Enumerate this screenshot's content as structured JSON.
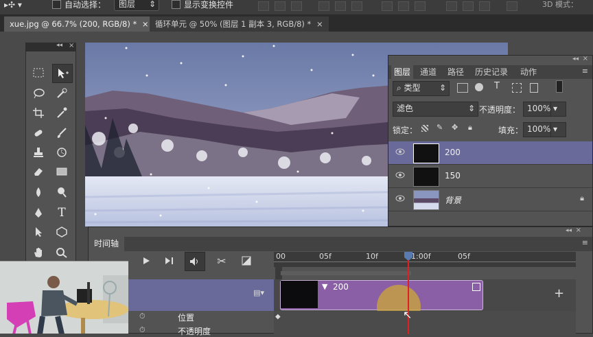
{
  "option_bar": {
    "auto_select_label": "自动选择：",
    "auto_select_value": "图层",
    "show_transform_label": "显示变换控件",
    "mode_3d_label": "3D 模式："
  },
  "doc_tabs": [
    {
      "label": "xue.jpg @ 66.7% (200, RGB/8) *",
      "close": "×"
    },
    {
      "label": "循环单元 @ 50% (图层 1 副本 3, RGB/8) *",
      "close": "×"
    }
  ],
  "tools": {
    "collapse": "◂◂",
    "close": "×",
    "items": [
      "rect-marquee",
      "move",
      "lasso",
      "quick-select",
      "crop",
      "eyedropper",
      "spot-heal",
      "brush",
      "clone-stamp",
      "history-brush",
      "eraser",
      "gradient",
      "blur",
      "dodge",
      "pen",
      "type",
      "path-select",
      "shape",
      "hand",
      "zoom"
    ]
  },
  "layers_panel": {
    "collapse": "◂◂",
    "close": "×",
    "tabs": [
      "图层",
      "通道",
      "路径",
      "历史记录",
      "动作"
    ],
    "active_tab": "图层",
    "filter_kind": "类型",
    "blend_mode": "滤色",
    "opacity_label": "不透明度：",
    "opacity_value": "100%",
    "lock_label": "锁定：",
    "fill_label": "填充：",
    "fill_value": "100%",
    "layers": [
      {
        "name": "200",
        "selected": true
      },
      {
        "name": "150",
        "selected": false
      },
      {
        "name": "背景",
        "selected": false,
        "locked": true
      }
    ]
  },
  "timeline": {
    "collapse": "◂◂",
    "close": "×",
    "tab_label": "时间轴",
    "ruler_ticks": [
      "00",
      "05f",
      "10f",
      "1:00f",
      "05f"
    ],
    "clip_label": "200",
    "properties": [
      "位置",
      "不透明度"
    ],
    "add_button": "+"
  },
  "colors": {
    "panel_bg": "#535353",
    "selected_layer": "#6a6a9a",
    "clip_purple": "#8a5fa6",
    "playhead_red": "#e02020"
  }
}
